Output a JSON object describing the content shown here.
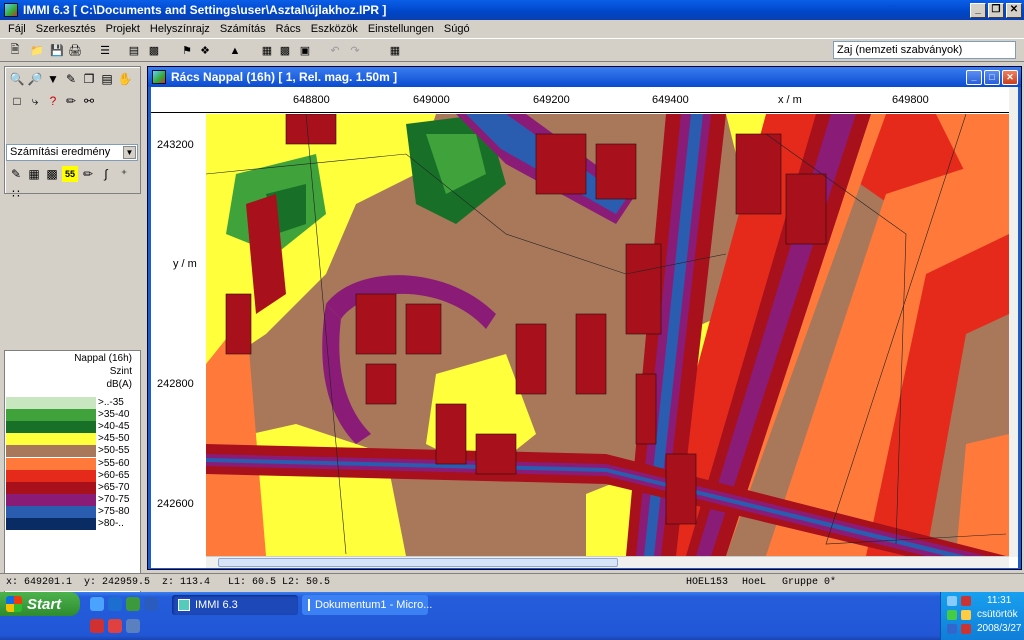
{
  "window": {
    "title": "IMMI 6.3 [ C:\\Documents and Settings\\user\\Asztal\\újlakhoz.IPR ]"
  },
  "menu": [
    "Fájl",
    "Szerkesztés",
    "Projekt",
    "Helyszínrajz",
    "Számítás",
    "Rács",
    "Eszközök",
    "Einstellungen",
    "Súgó"
  ],
  "toolbar": {
    "standard_select": "Zaj (nemzeti szabványok)"
  },
  "left_panel": {
    "result_select": "Számítási eredmény"
  },
  "legend": {
    "title_lines": [
      "Nappal (16h)",
      "Szint",
      "dB(A)"
    ],
    "entries": [
      {
        "label": ">..-35",
        "color": "#c8e6c0"
      },
      {
        "label": ">35-40",
        "color": "#3fa23a"
      },
      {
        "label": ">40-45",
        "color": "#187028"
      },
      {
        "label": ">45-50",
        "color": "#ffff3c"
      },
      {
        "label": ">50-55",
        "color": "#a9785a"
      },
      {
        "label": ">55-60",
        "color": "#ff7a3a"
      },
      {
        "label": ">60-65",
        "color": "#e52a1c"
      },
      {
        "label": ">65-70",
        "color": "#a8101c"
      },
      {
        "label": ">70-75",
        "color": "#8a1c78"
      },
      {
        "label": ">75-80",
        "color": "#2a5cb0"
      },
      {
        "label": ">80-..",
        "color": "#0a2c64"
      }
    ]
  },
  "grid_window": {
    "title": "Rács Nappal (16h)  [ 1, Rel. mag.  1.50m ]",
    "x_ticks": [
      "648800",
      "649000",
      "649200",
      "649400",
      "x / m",
      "649800"
    ],
    "y_ticks": [
      "243200",
      "y / m",
      "242800",
      "242600"
    ]
  },
  "status": {
    "x": "x: 649201.1",
    "y": "y: 242959.5",
    "z": "z:  113.4",
    "l1": "L1: 60.5",
    "l2": "L2: 50.5",
    "code": "HOEL153",
    "hoel": "HoeL",
    "gruppe": "Gruppe 0*"
  },
  "taskbar": {
    "start": "Start",
    "tasks": [
      "IMMI 6.3",
      "Dokumentum1 - Micro..."
    ],
    "clock": "11:31",
    "day": "csütörtök",
    "date": "2008/3/27"
  }
}
